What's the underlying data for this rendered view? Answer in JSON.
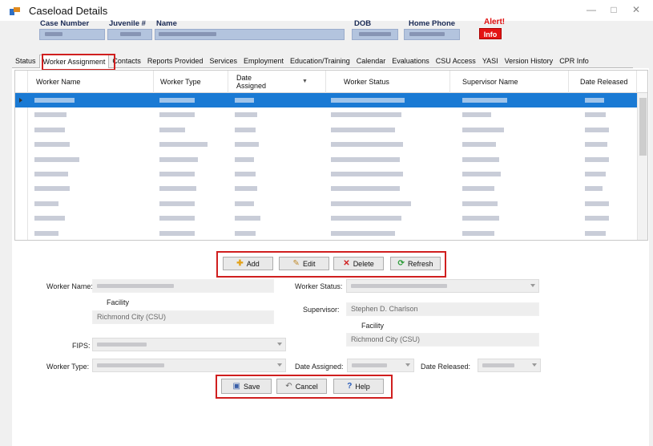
{
  "window": {
    "title": "Caseload Details",
    "minimize": "—",
    "maximize": "□",
    "close": "✕"
  },
  "header": {
    "case_number_label": "Case Number",
    "juvenile_label": "Juvenile #",
    "name_label": "Name",
    "dob_label": "DOB",
    "home_phone_label": "Home Phone",
    "alert_label": "Alert!",
    "info_button": "Info"
  },
  "tabs": [
    {
      "label": "Status"
    },
    {
      "label": "Worker Assignment",
      "active": true
    },
    {
      "label": "Contacts"
    },
    {
      "label": "Reports Provided"
    },
    {
      "label": "Services"
    },
    {
      "label": "Employment"
    },
    {
      "label": "Education/Training"
    },
    {
      "label": "Calendar"
    },
    {
      "label": "Evaluations"
    },
    {
      "label": "CSU Access"
    },
    {
      "label": "YASI"
    },
    {
      "label": "Version History"
    },
    {
      "label": "CPR Info"
    }
  ],
  "grid": {
    "columns": [
      "Worker Name",
      "Worker Type",
      "Date Assigned",
      "Worker Status",
      "Supervisor Name",
      "Date Released"
    ],
    "selected_row": 0,
    "row_count": 10
  },
  "toolbar": {
    "add": "Add",
    "edit": "Edit",
    "delete": "Delete",
    "refresh": "Refresh"
  },
  "form": {
    "worker_name_label": "Worker Name:",
    "worker_status_label": "Worker Status:",
    "facility_label": "Facility",
    "facility_value": "Richmond City (CSU)",
    "supervisor_label": "Supervisor:",
    "supervisor_value": "Stephen D. Charlson",
    "facility2_label": "Facility",
    "facility2_value": "Richmond City (CSU)",
    "fips_label": "FIPS:",
    "worker_type_label": "Worker Type:",
    "date_assigned_label": "Date Assigned:",
    "date_released_label": "Date Released:"
  },
  "actions": {
    "save": "Save",
    "cancel": "Cancel",
    "help": "Help"
  },
  "colors": {
    "selected_row": "#1a7ad4",
    "highlight": "#d01f1f",
    "header_box": "#b3c4de",
    "alert": "#e01010"
  }
}
